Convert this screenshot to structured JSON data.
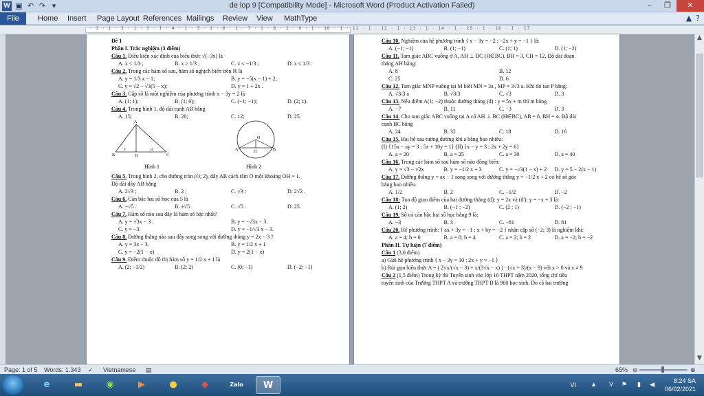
{
  "window": {
    "title": "de lop 9 [Compatibility Mode] - Microsoft Word (Product Activation Failed)",
    "app_icon_label": "W",
    "qat_icons": [
      "save-icon",
      "undo-icon",
      "redo-icon",
      "customize-icon"
    ],
    "controls": [
      "minimize-icon",
      "maximize-icon",
      "close-icon"
    ]
  },
  "ribbon": {
    "tabs": [
      {
        "label": "File",
        "active": true
      },
      {
        "label": "Home"
      },
      {
        "label": "Insert"
      },
      {
        "label": "Page Layout"
      },
      {
        "label": "References"
      },
      {
        "label": "Mailings"
      },
      {
        "label": "Review"
      },
      {
        "label": "View"
      },
      {
        "label": "MathType"
      }
    ],
    "right_icons": [
      "chevron-up-icon",
      "help-icon"
    ]
  },
  "ruler": {
    "ticks": "· 1 · 1 · 2 · 1 · 3 · 1 · 4 · 1 · 5 · 1 · 6 · 1 · 7 · 1 · 8 · 1 · 9 · 1 · 10 · 1 · 11 · 1 · 12 · 1 · 13 · 1 · 14 · 1 · 15 · 1 · 16 · 1 · 17"
  },
  "page1": {
    "lines": [
      {
        "t": "Đề 1",
        "cls": "h"
      },
      {
        "t": "Phần I. Trắc nghiệm (3 điểm)",
        "cls": "h"
      },
      {
        "q": "Câu 1.",
        "t": " Điều kiện xác định của biểu thức √(−3x) là"
      },
      {
        "opts": [
          "A. x < 1/3 ;",
          "B. x ≥ 1/3 ;",
          "C. x ≤ −1/3 ;",
          "D. x ≤ 1/3 ."
        ]
      },
      {
        "q": "Câu 2.",
        "t": " Trong các hàm số sau, hàm số nghịch biến trên ℝ là"
      },
      {
        "opts2": [
          "A. y = 1/3 x − 1;",
          "B. y = −5(x − 1) + 2;",
          "C. y = √2 − √3(5 − x);",
          "D. y = 1 + 2x ."
        ]
      },
      {
        "q": "Câu 3.",
        "t": " Cặp số là một nghiệm của phương trình x − 3y = 2 là"
      },
      {
        "opts": [
          "A. (1; 1);",
          "B. (1; 0);",
          "C. (−1; −1);",
          "D. (2; 1)."
        ]
      },
      {
        "q": "Câu 4.",
        "t": " Trong hình 1, độ dài cạnh AB bằng"
      },
      {
        "opts": [
          "A. 15;",
          "B. 20;",
          "C. 12;",
          "D. 25."
        ]
      }
    ],
    "fig_captions": [
      "Hình 1",
      "Hình 2"
    ],
    "fig_labels": {
      "f1": [
        "A",
        "B",
        "H",
        "C",
        "9",
        "16"
      ],
      "f2": [
        "O",
        "A",
        "H",
        "B"
      ]
    },
    "lines2": [
      {
        "q": "Câu 5.",
        "t": " Trong hình 2, cho đường tròn (O; 2), dây AB cách tâm O một khoảng OH = 1."
      },
      {
        "t": "Độ dài dây AB bằng"
      },
      {
        "opts": [
          "A. 2√3 ;",
          "B. 2 ;",
          "C. √3 ;",
          "D. 2√2 ."
        ]
      },
      {
        "q": "Câu 6.",
        "t": " Căn bậc hai số học của 5 là"
      },
      {
        "opts": [
          "A. −√5 .",
          "B. ±√5 .",
          "C. √5 .",
          "D. 25."
        ]
      },
      {
        "q": "Câu 7.",
        "t": " Hàm số nào sau đây là hàm số bậc nhất?"
      },
      {
        "opts2": [
          "A. y = √3x − 3 .",
          "B. y = −√3x − 3.",
          "C. y = −3.",
          "D. y = −1/√3 x − 3."
        ]
      },
      {
        "q": "Câu 8.",
        "t": " Đường thẳng nào sau đây song song với đường thẳng y = 2x − 3 ?"
      },
      {
        "opts2": [
          "A. y = 3x − 3.",
          "B. y = 1/2 x + 1",
          "C. y = −2(1 − x)",
          "D. y = 2(1 − x)"
        ]
      },
      {
        "q": "Câu 9.",
        "t": " Điểm thuộc đồ thị hàm số y = 1/2 x + 1 là"
      },
      {
        "opts": [
          "A. (2; −1/2)",
          "B. (2; 2)",
          "C. (0; −1)",
          "D. (−2; −1)"
        ]
      }
    ]
  },
  "page2": {
    "lines": [
      {
        "q": "Câu 10.",
        "t": " Nghiệm của hệ phương trình { x − 3y = −2 ; −2x + y = −1 } là:"
      },
      {
        "opts": [
          "A. (−1; −1)",
          "B. (1; −1)",
          "C. (1; 1)",
          "D. (1; −2)"
        ]
      },
      {
        "q": "Câu 11.",
        "t": " Tam giác ABC vuông ở A, AH ⊥ BC (H∈BC), BH = 3, CH = 12. Độ dài đoạn"
      },
      {
        "t": "thẳng AH bằng:"
      },
      {
        "opts2": [
          "A. 8",
          "B. 12",
          "C. 25",
          "D. 6"
        ]
      },
      {
        "q": "Câu 12.",
        "t": " Tam giác MNP vuông tại M biết MN = 3a , MP = 3√3 a. Khi đó tan P bằng:"
      },
      {
        "opts": [
          "A. √3/3 a",
          "B. √3/3",
          "C. √3",
          "D. 3"
        ]
      },
      {
        "q": "Câu 13.",
        "t": " Nếu điểm A(1; −2) thuộc đường thẳng (d) : y = 5x + m thì m bằng"
      },
      {
        "opts": [
          "A. −7",
          "B. 11",
          "C. −3",
          "D. 3"
        ]
      },
      {
        "q": "Câu 14.",
        "t": " Cho tam giác ABC vuông tại A có AH ⊥ BC (H∈BC), AB = 8, BH = 4. Độ dài"
      },
      {
        "t": "cạnh BC bằng"
      },
      {
        "opts": [
          "A. 24",
          "B. 32",
          "C. 18",
          "D. 16"
        ]
      },
      {
        "q": "Câu 15.",
        "t": " Hai hệ sau tương đương khi a bằng bao nhiêu:"
      },
      {
        "t": "(I) {15x − ay = 3 ; 5x + 10y = 1}      (II) {x − y = 3 ; 2x + 2y = 6}"
      },
      {
        "opts": [
          "A. a = 20",
          "B. a = 25",
          "C. a = 30",
          "D. a = 40"
        ]
      },
      {
        "q": "Câu 16.",
        "t": " Trong các hàm số sau hàm số nào đồng biến:"
      },
      {
        "opts": [
          "A. y = √3 − √2x",
          "B. y = −1/2 x + 3",
          "C. y = −√3(1 − x) + 2",
          "D. y = 5 − 2(x − 1)"
        ]
      },
      {
        "q": "Câu 17.",
        "t": " Đường thẳng y = ax − 1 song song với đường thẳng y = −1/2 x + 2 có hệ số góc"
      },
      {
        "t": "bằng bao nhiêu."
      },
      {
        "opts": [
          "A. 1/2",
          "B. 2",
          "C. −1/2",
          "D. −2"
        ]
      },
      {
        "q": "Câu 18:",
        "t": " Tọa độ giao điểm của hai đường thẳng (d): y = 2x và (d'): y = −x + 3 là:"
      },
      {
        "opts": [
          "A. (1; 2)",
          "B. (−1 ; −2)",
          "C. (2 ; 1)",
          "D. (−2 ; −1)"
        ]
      },
      {
        "q": "Câu 19.",
        "t": " Số có căn bậc hai số học bằng 9 là:"
      },
      {
        "opts": [
          "A. −3",
          "B. 3",
          "C. −81",
          "D. 81"
        ]
      },
      {
        "q": "Câu 20.",
        "t": " Hệ phương trình: { ax + 3y = −1 ; x + by = −2 } nhận cặp số (−2; 3) là nghiệm khi:"
      },
      {
        "opts": [
          "A. a = 4; b = 0",
          "B. a = 0; b = 4",
          "C. a = 2; b = 2",
          "D. a = −2; b = −2"
        ]
      },
      {
        "t": "Phần II. Tự luận (7 điểm)",
        "cls": "h"
      },
      {
        "q": "Câu 1",
        "t": " (3,0 điểm)"
      },
      {
        "t": "a) Giải hệ phương trình { x − 3y = 10 ; 2x + y = −1 }"
      },
      {
        "t": "b) Rút gọn biểu thức A = ( 2√x/(√x − 3) + x/(3√x − x) ) · (√x + 3)/(x − 9)   với x > 0 và x ≠ 9"
      },
      {
        "q": "Câu 2",
        "t": " (1,5 điểm) Trong kỳ thi Tuyển sinh vào lớp 10 THPT năm 2020, tổng chỉ tiêu"
      },
      {
        "t": "tuyển sinh của Trường THPT A và trường THPT B là 900 học sinh. Do cả hai trường"
      }
    ]
  },
  "status": {
    "page": "Page: 1 of 5",
    "words": "Words: 1.343",
    "language": "Vietnamese",
    "zoom": "65%",
    "zoom_level": 0.65
  },
  "taskbar": {
    "apps": [
      "internet-explorer-icon",
      "file-explorer-icon",
      "winamp-icon",
      "media-player-icon",
      "chrome-icon",
      "app-icon",
      "zalo-icon",
      "word-icon"
    ],
    "zalo_label": "Zalo",
    "word_label": "W",
    "lang": "VI",
    "time": "8:24 SA",
    "date": "06/02/2021"
  }
}
